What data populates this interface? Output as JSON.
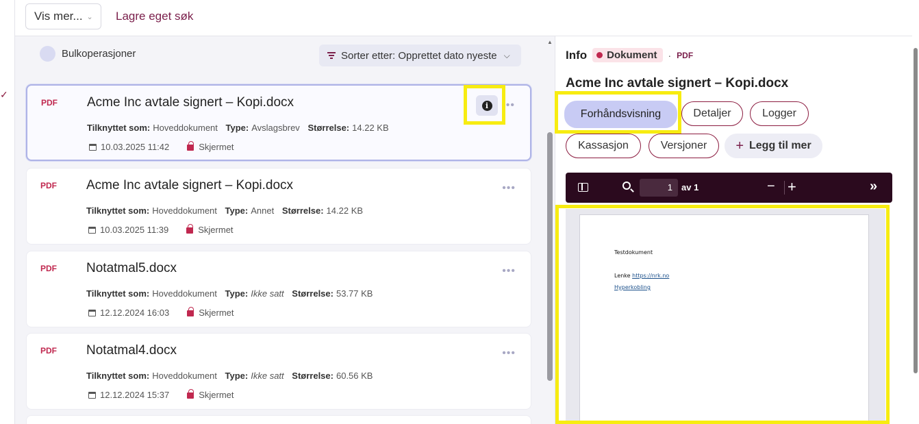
{
  "topbar": {
    "vis_mer_label": "Vis mer...",
    "lagre_label": "Lagre eget søk"
  },
  "list": {
    "bulk_label": "Bulkoperasjoner",
    "sort_label": "Sorter etter: Opprettet dato nyeste",
    "labels": {
      "attached": "Tilknyttet som:",
      "type": "Type:",
      "size": "Størrelse:"
    },
    "items": [
      {
        "format": "PDF",
        "title": "Acme Inc avtale signert – Kopi.docx",
        "attached": "Hoveddokument",
        "type": "Avslagsbrev",
        "size": "14.22 KB",
        "date": "10.03.2025 11:42",
        "status": "Skjermet"
      },
      {
        "format": "PDF",
        "title": "Acme Inc avtale signert – Kopi.docx",
        "attached": "Hoveddokument",
        "type": "Annet",
        "size": "14.22 KB",
        "date": "10.03.2025 11:39",
        "status": "Skjermet"
      },
      {
        "format": "PDF",
        "title": "Notatmal5.docx",
        "attached": "Hoveddokument",
        "type": "Ikke satt",
        "size": "53.77 KB",
        "date": "12.12.2024 16:03",
        "status": "Skjermet"
      },
      {
        "format": "PDF",
        "title": "Notatmal4.docx",
        "attached": "Hoveddokument",
        "type": "Ikke satt",
        "size": "60.56 KB",
        "date": "12.12.2024 15:37",
        "status": "Skjermet"
      }
    ],
    "more_glyph": "•••",
    "info_glyph": "i"
  },
  "info": {
    "label": "Info",
    "badge": "Dokument",
    "separator": "·",
    "format": "PDF",
    "title": "Acme Inc avtale signert – Kopi.docx",
    "tabs": [
      "Forhåndsvisning",
      "Detaljer",
      "Logger",
      "Kassasjon",
      "Versjoner"
    ],
    "add_label": "Legg til mer",
    "active_tab": "Forhåndsvisning",
    "viewer": {
      "page_value": "1",
      "page_of": "av 1",
      "zoom_out": "−",
      "zoom_in": "+",
      "more": "»",
      "doc_line1": "Testdokument",
      "doc_line2_prefix": "Lenke ",
      "doc_line2_link": "https://nrk.no",
      "doc_line3_link": "Hyperkobling"
    }
  },
  "colors": {
    "accent": "#7a1f4b",
    "pdf_red": "#c0284f",
    "highlight": "#f7ec11",
    "active_tab": "#c8cbf4",
    "toolbar": "#2b0a1e"
  }
}
